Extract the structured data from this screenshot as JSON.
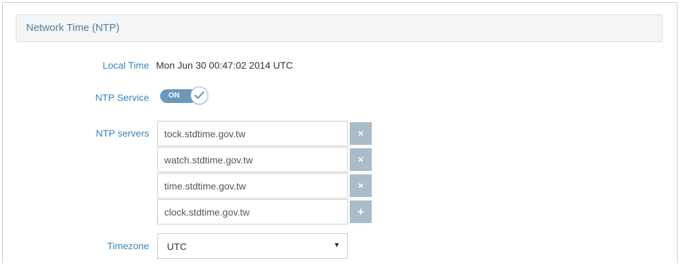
{
  "section": {
    "title": "Network Time (NTP)"
  },
  "local_time": {
    "label": "Local Time",
    "value": "Mon Jun 30 00:47:02 2014 UTC"
  },
  "ntp_service": {
    "label": "NTP Service",
    "state": "ON",
    "icon": "checkmark-icon"
  },
  "ntp_servers": {
    "label": "NTP servers",
    "servers": [
      {
        "value": "tock.stdtime.gov.tw",
        "action": "×",
        "action_icon": "remove-icon"
      },
      {
        "value": "watch.stdtime.gov.tw",
        "action": "×",
        "action_icon": "remove-icon"
      },
      {
        "value": "time.stdtime.gov.tw",
        "action": "×",
        "action_icon": "remove-icon"
      },
      {
        "value": "clock.stdtime.gov.tw",
        "action": "+",
        "action_icon": "add-icon"
      }
    ]
  },
  "timezone": {
    "label": "Timezone",
    "selected": "UTC",
    "caret": "▼"
  },
  "colors": {
    "label": "#3b84b6",
    "title": "#4f7d9e",
    "toggle_on": "#6c98bb",
    "row_button": "#a9bcc8"
  }
}
